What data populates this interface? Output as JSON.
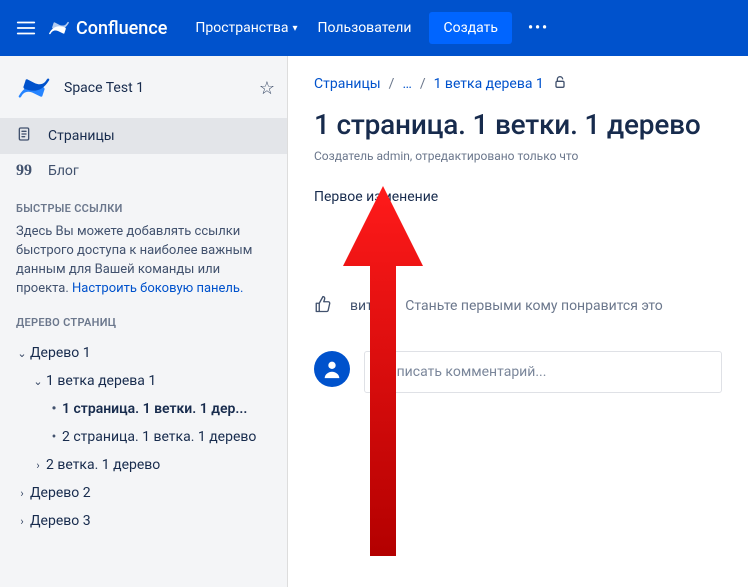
{
  "topnav": {
    "brand": "Confluence",
    "spaces": "Пространства",
    "users": "Пользователи",
    "create": "Создать"
  },
  "sidebar": {
    "space_name": "Space Test 1",
    "pages": "Страницы",
    "blog": "Блог",
    "quick_links_title": "БЫСТРЫЕ ССЫЛКИ",
    "quick_links_text": "Здесь Вы можете добавлять ссылки быстрого доступа к наиболее важным данным для Вашей команды или проекта.",
    "configure_link": "Настроить боковую панель.",
    "page_tree_title": "ДЕРЕВО СТРАНИЦ",
    "tree": {
      "t1": "Дерево 1",
      "b1": "1 ветка дерева 1",
      "p1": "1 страница. 1 ветки. 1 дер...",
      "p2": "2 страница. 1 ветка. 1 дерево",
      "b2": "2 ветка. 1 дерево",
      "t2": "Дерево 2",
      "t3": "Дерево 3"
    }
  },
  "main": {
    "crumb_pages": "Страницы",
    "crumb_dots": "…",
    "crumb_parent": "1 ветка дерева 1",
    "title": "1 страница. 1 ветки. 1 дерево",
    "byline": "Создатель admin, отредактировано только что",
    "body": "Первое изменение",
    "like_label": "вится",
    "like_prompt": "Станьте первыми кому понравится это",
    "comment_placeholder": "Написать комментарий..."
  }
}
